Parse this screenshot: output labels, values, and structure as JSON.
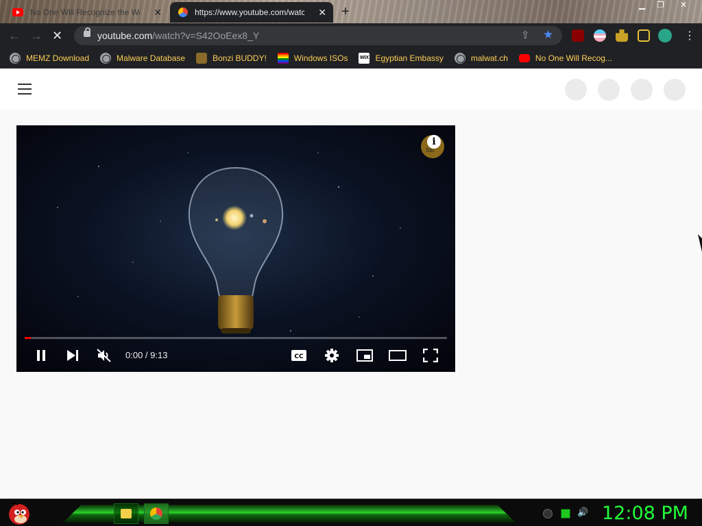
{
  "tabs": [
    {
      "title": "No One Will Recognize the Wo...",
      "active": false
    },
    {
      "title": "https://www.youtube.com/watch?v=...",
      "active": true
    }
  ],
  "address_bar": {
    "host": "youtube.com",
    "path": "/watch?v=S42OoEex8_Y"
  },
  "bookmarks": [
    {
      "label": "MEMZ Download",
      "icon": "globe-icon"
    },
    {
      "label": "Malware Database",
      "icon": "globe-icon"
    },
    {
      "label": "Bonzi BUDDY!",
      "icon": "bonzi-icon"
    },
    {
      "label": "Windows ISOs",
      "icon": "rainbow-flag-icon"
    },
    {
      "label": "Egyptian Embassy",
      "icon": "wix-icon"
    },
    {
      "label": "malwat.ch",
      "icon": "globe-icon"
    },
    {
      "label": "No One Will Recog...",
      "icon": "youtube-icon"
    }
  ],
  "player": {
    "time": "0:00 / 9:13",
    "progress": 0.015,
    "muted": true,
    "info_icon": "i",
    "badge_label": "Stu"
  },
  "taskbar": {
    "clock": "12:08 PM"
  },
  "colors": {
    "bookmark_text": "#ffd05a",
    "clock": "#22ff3a",
    "progress": "#ff0000"
  }
}
